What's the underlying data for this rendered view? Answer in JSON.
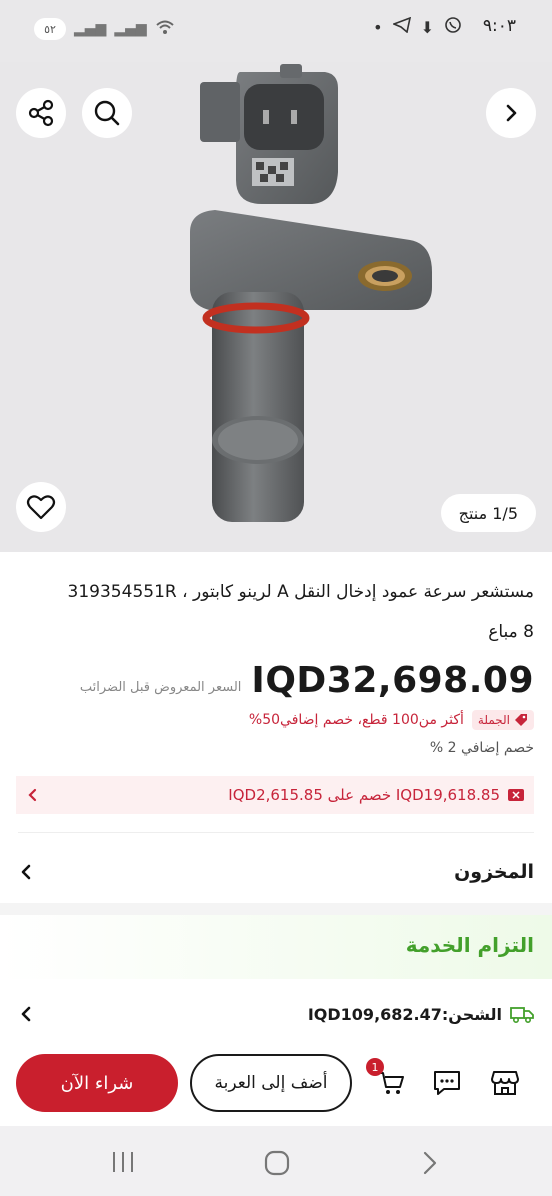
{
  "status_bar": {
    "time": "٩:٠٣",
    "battery": "٥٢"
  },
  "gallery": {
    "counter": "1/5 منتج"
  },
  "product": {
    "title": "مستشعر سرعة عمود إدخال النقل A لرينو كابتور ، 319354551R",
    "sold": "8 مباع",
    "price": "IQD32,698.09",
    "price_note": "السعر المعروض قبل الضرائب",
    "wholesale_badge": "الجملة",
    "wholesale_text": "أكثر من100 قطع، خصم إضافي50%",
    "extra_discount": "خصم إضافي 2 %",
    "promo_text": "IQD19,618.85 خصم على IQD2,615.85"
  },
  "stock": {
    "label": "المخزون"
  },
  "service": {
    "title": "التزام الخدمة",
    "shipping": "الشحن:IQD109,682.47"
  },
  "actions": {
    "buy_now": "شراء الآن",
    "add_to_cart": "أضف إلى العربة",
    "cart_count": "1"
  },
  "colors": {
    "brand_red": "#c91f2d",
    "service_green": "#43a02b"
  }
}
